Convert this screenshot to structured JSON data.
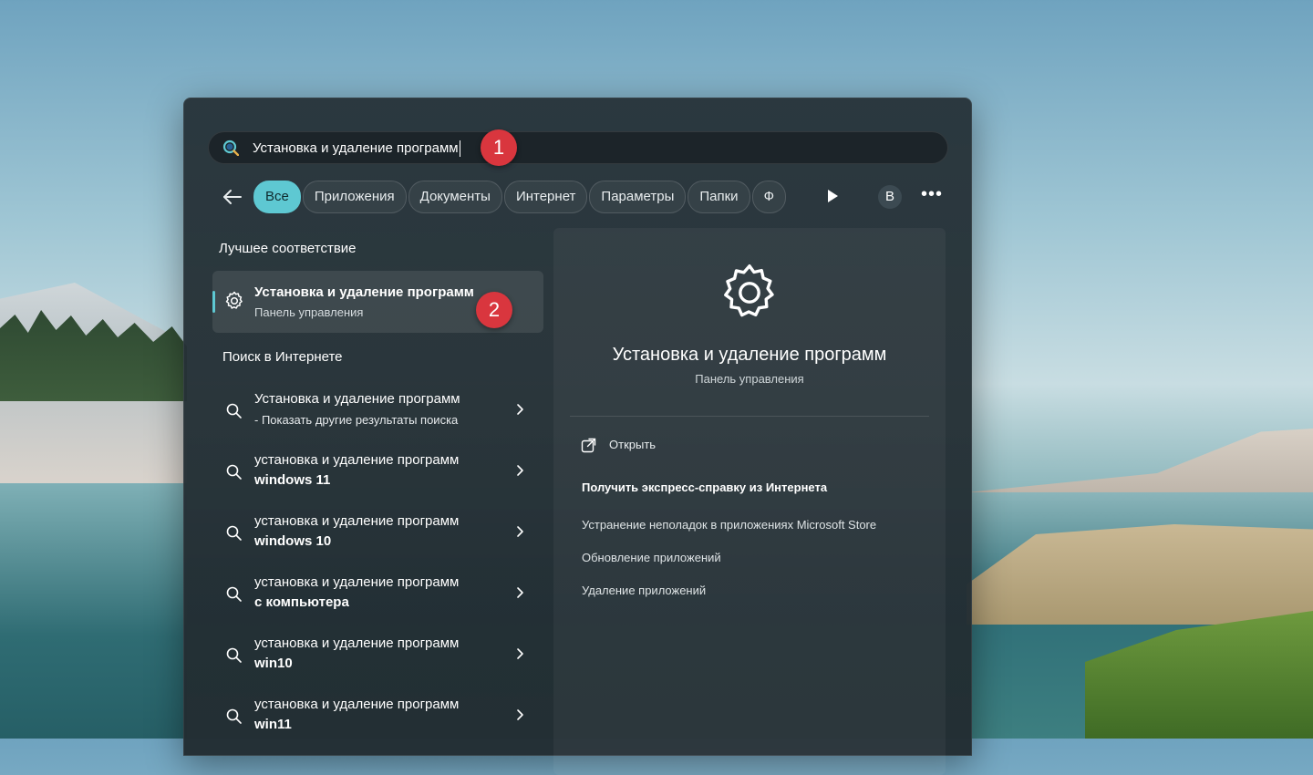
{
  "search": {
    "query": "Установка и удаление программ",
    "step_badge": "1"
  },
  "filters": {
    "chips": [
      "Все",
      "Приложения",
      "Документы",
      "Интернет",
      "Параметры",
      "Папки",
      "Ф"
    ],
    "active_index": 0,
    "profile_initial": "B",
    "more_label": "•••"
  },
  "best_match": {
    "heading": "Лучшее соответствие",
    "title": "Установка и удаление программ",
    "subtitle": "Панель управления",
    "step_badge": "2",
    "icon": "gear-icon"
  },
  "web_search": {
    "heading": "Поиск в Интернете",
    "items": [
      {
        "line1": "Установка и удаление программ",
        "line2": "- Показать другие результаты поиска"
      },
      {
        "line1": "установка и удаление программ",
        "line2": "windows 11"
      },
      {
        "line1": "установка и удаление программ",
        "line2": "windows 10"
      },
      {
        "line1": "установка и удаление программ",
        "line2": "с компьютера"
      },
      {
        "line1": "установка и удаление программ",
        "line2": "win10"
      },
      {
        "line1": "установка и удаление программ",
        "line2": "win11"
      }
    ]
  },
  "detail": {
    "title": "Установка и удаление программ",
    "subtitle": "Панель управления",
    "open_label": "Открыть",
    "help_heading": "Получить экспресс-справку из Интернета",
    "links": [
      "Устранение неполадок в приложениях Microsoft Store",
      "Обновление приложений",
      "Удаление приложений"
    ]
  },
  "colors": {
    "accent": "#5ec8d2",
    "badge": "#d9363e",
    "panel": "#28343a"
  }
}
